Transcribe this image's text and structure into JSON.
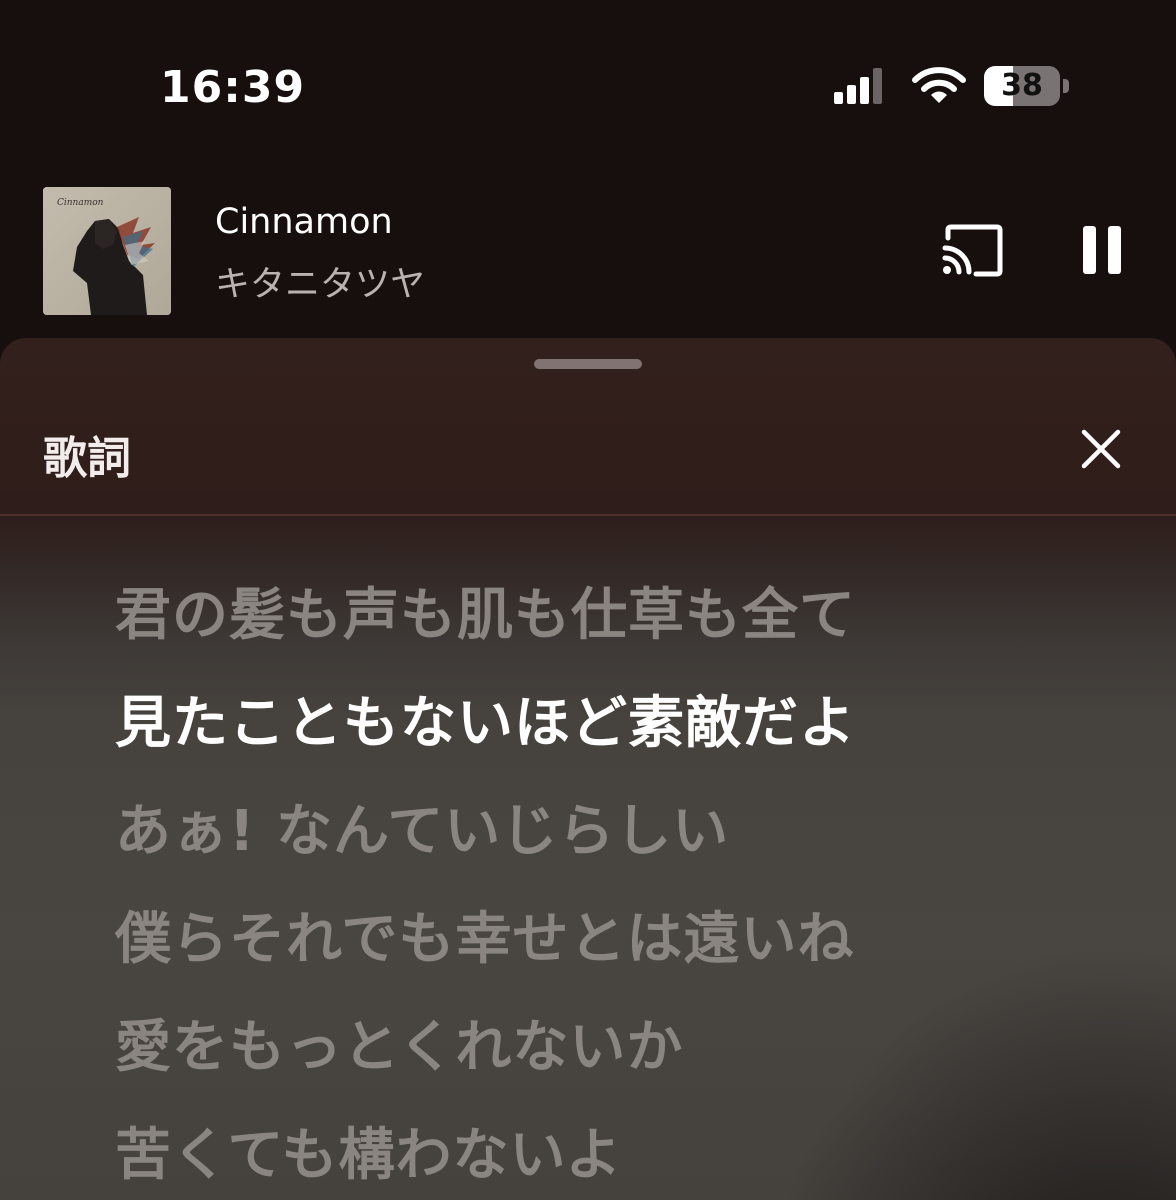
{
  "status_bar": {
    "time": "16:39",
    "battery_level": "38",
    "battery_percent": 38,
    "signal_bars": 3,
    "signal_bars_total": 4,
    "icons": [
      "cellular-signal-icon",
      "wifi-icon",
      "battery-icon"
    ]
  },
  "now_playing": {
    "title": "Cinnamon",
    "artist": "キタニタツヤ",
    "album_art": "album-art-image",
    "cast_icon": "cast-icon",
    "pause_icon": "pause-icon"
  },
  "lyrics_sheet": {
    "title": "歌詞",
    "close_icon": "close-icon",
    "lines": [
      "君の髪も声も肌も仕草も全て",
      "見たこともないほど素敵だよ",
      "あぁ! なんていじらしい",
      "僕らそれでも幸せとは遠いね",
      "愛をもっとくれないか",
      "苦くても構わないよ"
    ],
    "active_line_index": 1
  },
  "colors": {
    "background": "#160f0e",
    "sheet_top": "#33201c",
    "sheet_body": "#494541",
    "lyric_active": "#ffffff",
    "lyric_inactive": "#8a8580",
    "artist_text": "#b9b2b0"
  }
}
